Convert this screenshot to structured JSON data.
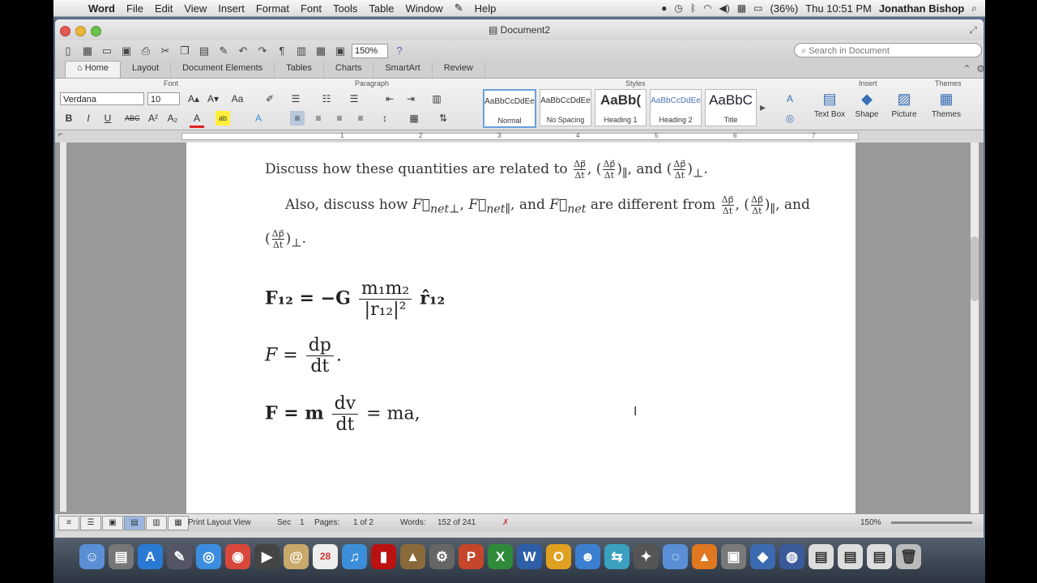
{
  "menubar": {
    "app": "Word",
    "items": [
      "File",
      "Edit",
      "View",
      "Insert",
      "Format",
      "Font",
      "Tools",
      "Table",
      "Window",
      "Help"
    ],
    "battery": "(36%)",
    "clock": "Thu 10:51 PM",
    "user": "Jonathan Bishop"
  },
  "window": {
    "title": "Document2"
  },
  "toolbar": {
    "zoom": "150%",
    "search_placeholder": "Search in Document"
  },
  "tabs": [
    "Home",
    "Layout",
    "Document Elements",
    "Tables",
    "Charts",
    "SmartArt",
    "Review"
  ],
  "ribbon": {
    "groups": {
      "font": "Font",
      "paragraph": "Paragraph",
      "styles": "Styles",
      "insert": "Insert",
      "themes": "Themes"
    },
    "font_name": "Verdana",
    "font_size": "10",
    "styles": [
      {
        "preview": "AaBbCcDdEe",
        "label": "Normal"
      },
      {
        "preview": "AaBbCcDdEe",
        "label": "No Spacing"
      },
      {
        "preview": "AaBb(",
        "label": "Heading 1"
      },
      {
        "preview": "AaBbCcDdEe",
        "label": "Heading 2"
      },
      {
        "preview": "AaBbC",
        "label": "Title"
      }
    ],
    "insert_buttons": [
      "Text Box",
      "Shape",
      "Picture"
    ],
    "themes_button": "Themes"
  },
  "ruler": {
    "numbers": [
      "1",
      "2",
      "3",
      "4",
      "5",
      "6",
      "7"
    ]
  },
  "document": {
    "line1_prefix": "Discuss how these quantities are related to",
    "line1_sep1": ",",
    "line1_and": ", and",
    "line1_end": ".",
    "line2_prefix": "Also, discuss how",
    "line2_mid": "are different from",
    "line2_and": ", and",
    "line2_and2": "and",
    "frac_num": "Δp⃗",
    "frac_den": "Δt",
    "eq1_lhs": "F₁₂ = −G",
    "eq1_num": "m₁m₂",
    "eq1_den": "|r₁₂|²",
    "eq1_rhs": "r̂₁₂",
    "eq2_lhs": "F =",
    "eq2_num": "dp",
    "eq2_den": "dt",
    "eq2_end": ".",
    "eq3_lhs": "F = m",
    "eq3_num": "dv",
    "eq3_den": "dt",
    "eq3_rhs": "= ma,"
  },
  "status": {
    "view": "Print Layout View",
    "sec_label": "Sec",
    "sec": "1",
    "pages_label": "Pages:",
    "pages": "1 of 2",
    "words_label": "Words:",
    "words": "152 of 241",
    "zoom": "150%"
  },
  "dock": {
    "badge_calendar": "28"
  }
}
